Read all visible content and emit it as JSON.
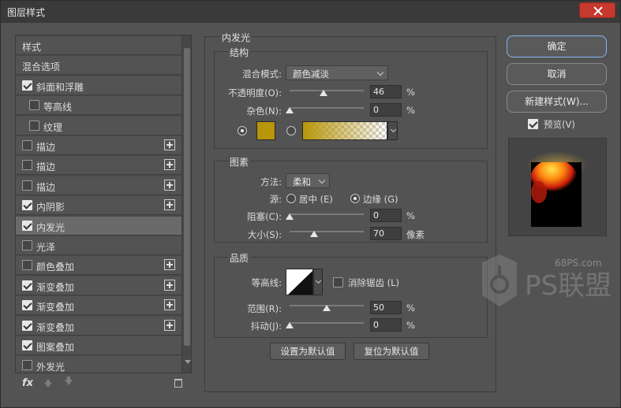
{
  "window": {
    "title": "图层样式"
  },
  "colors": {
    "glow_color": "#b8960a",
    "gradient_start": "#b8960a",
    "primary_border": "#8fb0d8"
  },
  "sidebar": {
    "items": [
      {
        "label": "样式",
        "checkbox": false,
        "checked": false,
        "plus": false,
        "indent": 0,
        "selected": false
      },
      {
        "label": "混合选项",
        "checkbox": false,
        "checked": false,
        "plus": false,
        "indent": 0,
        "selected": false
      },
      {
        "label": "斜面和浮雕",
        "checkbox": true,
        "checked": true,
        "plus": false,
        "indent": 0,
        "selected": false
      },
      {
        "label": "等高线",
        "checkbox": true,
        "checked": false,
        "plus": false,
        "indent": 1,
        "selected": false
      },
      {
        "label": "纹理",
        "checkbox": true,
        "checked": false,
        "plus": false,
        "indent": 1,
        "selected": false
      },
      {
        "label": "描边",
        "checkbox": true,
        "checked": false,
        "plus": true,
        "indent": 0,
        "selected": false
      },
      {
        "label": "描边",
        "checkbox": true,
        "checked": false,
        "plus": true,
        "indent": 0,
        "selected": false
      },
      {
        "label": "描边",
        "checkbox": true,
        "checked": false,
        "plus": true,
        "indent": 0,
        "selected": false
      },
      {
        "label": "内阴影",
        "checkbox": true,
        "checked": true,
        "plus": true,
        "indent": 0,
        "selected": false
      },
      {
        "label": "内发光",
        "checkbox": true,
        "checked": true,
        "plus": false,
        "indent": 0,
        "selected": true
      },
      {
        "label": "光泽",
        "checkbox": true,
        "checked": false,
        "plus": false,
        "indent": 0,
        "selected": false
      },
      {
        "label": "颜色叠加",
        "checkbox": true,
        "checked": false,
        "plus": true,
        "indent": 0,
        "selected": false
      },
      {
        "label": "渐变叠加",
        "checkbox": true,
        "checked": true,
        "plus": true,
        "indent": 0,
        "selected": false
      },
      {
        "label": "渐变叠加",
        "checkbox": true,
        "checked": true,
        "plus": true,
        "indent": 0,
        "selected": false
      },
      {
        "label": "渐变叠加",
        "checkbox": true,
        "checked": true,
        "plus": true,
        "indent": 0,
        "selected": false
      },
      {
        "label": "图案叠加",
        "checkbox": true,
        "checked": true,
        "plus": false,
        "indent": 0,
        "selected": false
      },
      {
        "label": "外发光",
        "checkbox": true,
        "checked": false,
        "plus": false,
        "indent": 0,
        "selected": false
      }
    ],
    "fx_label": "fx"
  },
  "panel": {
    "title": "内发光",
    "structure": {
      "title": "结构",
      "blend_mode_label": "混合模式:",
      "blend_mode_value": "颜色减淡",
      "opacity_label": "不透明度(O):",
      "opacity_value": "46",
      "opacity_fraction": 0.46,
      "noise_label": "杂色(N):",
      "noise_value": "0",
      "noise_fraction": 0,
      "percent": "%"
    },
    "elements": {
      "title": "图素",
      "method_label": "方法:",
      "method_value": "柔和",
      "source_label": "源:",
      "source_center": "居中 (E)",
      "source_edge": "边缘 (G)",
      "choke_label": "阻塞(C):",
      "choke_value": "0",
      "choke_fraction": 0,
      "size_label": "大小(S):",
      "size_value": "70",
      "size_fraction": 0.28,
      "size_unit": "像素",
      "percent": "%"
    },
    "quality": {
      "title": "品质",
      "contour_label": "等高线:",
      "antialias_label": "消除锯齿 (L)",
      "range_label": "范围(R):",
      "range_value": "50",
      "range_fraction": 0.5,
      "jitter_label": "抖动(J):",
      "jitter_value": "0",
      "jitter_fraction": 0,
      "percent": "%"
    },
    "set_default": "设置为默认值",
    "reset_default": "复位为默认值"
  },
  "actions": {
    "ok": "确定",
    "cancel": "取消",
    "new_style": "新建样式(W)...",
    "preview_label": "预览(V)",
    "preview_checked": true
  },
  "watermark": {
    "url": "68PS.com",
    "brand": "PS联盟"
  }
}
